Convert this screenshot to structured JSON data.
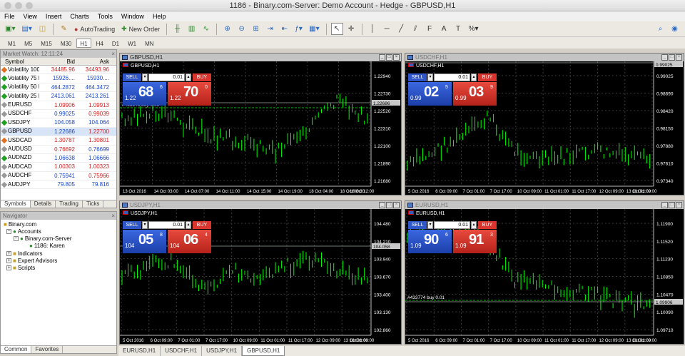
{
  "window": {
    "title": "1186 - Binary.com-Server: Demo Account - Hedge - GBPUSD,H1"
  },
  "menu": [
    "File",
    "View",
    "Insert",
    "Charts",
    "Tools",
    "Window",
    "Help"
  ],
  "toolbar": {
    "autotrading": "AutoTrading",
    "new_order": "New Order"
  },
  "timeframes": [
    "M1",
    "M5",
    "M15",
    "M30",
    "H1",
    "H4",
    "D1",
    "W1",
    "MN"
  ],
  "market_watch": {
    "title": "Market Watch: 12:11:24",
    "headers": {
      "symbol": "Symbol",
      "bid": "Bid",
      "ask": "Ask"
    },
    "rows": [
      {
        "symbol": "Volatility 100 In...",
        "bid": "34485.96",
        "ask": "34493.96",
        "bidc": "#d02020",
        "askc": "#d02020",
        "icon": "#e07020"
      },
      {
        "symbol": "Volatility 75 Index",
        "bid": "15926....",
        "ask": "15930....",
        "bidc": "#1a47c8",
        "askc": "#1a47c8",
        "icon": "#20a020"
      },
      {
        "symbol": "Volatility 50 Index",
        "bid": "464.2872",
        "ask": "464.3472",
        "bidc": "#1a47c8",
        "askc": "#1a47c8",
        "icon": "#20a020"
      },
      {
        "symbol": "Volatility 25 Index",
        "bid": "2413.061",
        "ask": "2413.261",
        "bidc": "#1a47c8",
        "askc": "#1a47c8",
        "icon": "#20a020"
      },
      {
        "symbol": "EURUSD",
        "bid": "1.09906",
        "ask": "1.09913",
        "bidc": "#d02020",
        "askc": "#d02020",
        "icon": "#999999"
      },
      {
        "symbol": "USDCHF",
        "bid": "0.99025",
        "ask": "0.99039",
        "bidc": "#1a47c8",
        "askc": "#d02020",
        "icon": "#999999"
      },
      {
        "symbol": "USDJPY",
        "bid": "104.058",
        "ask": "104.064",
        "bidc": "#1a47c8",
        "askc": "#1a47c8",
        "icon": "#20a020"
      },
      {
        "symbol": "GBPUSD",
        "bid": "1.22686",
        "ask": "1.22700",
        "bidc": "#1a47c8",
        "askc": "#d02020",
        "icon": "#999999",
        "selected": true
      },
      {
        "symbol": "USDCAD",
        "bid": "1.30787",
        "ask": "1.30801",
        "bidc": "#d02020",
        "askc": "#d02020",
        "icon": "#e07020"
      },
      {
        "symbol": "AUDUSD",
        "bid": "0.76692",
        "ask": "0.76699",
        "bidc": "#d02020",
        "askc": "#1a47c8",
        "icon": "#999999"
      },
      {
        "symbol": "AUDNZD",
        "bid": "1.06638",
        "ask": "1.06666",
        "bidc": "#1a47c8",
        "askc": "#1a47c8",
        "icon": "#20a020"
      },
      {
        "symbol": "AUDCAD",
        "bid": "1.00303",
        "ask": "1.00323",
        "bidc": "#d02020",
        "askc": "#d02020",
        "icon": "#999999"
      },
      {
        "symbol": "AUDCHF",
        "bid": "0.75941",
        "ask": "0.75966",
        "bidc": "#1a47c8",
        "askc": "#d02020",
        "icon": "#999999"
      },
      {
        "symbol": "AUDJPY",
        "bid": "79.805",
        "ask": "79.816",
        "bidc": "#1a47c8",
        "askc": "#1a47c8",
        "icon": "#999999"
      }
    ],
    "tabs": [
      "Symbols",
      "Details",
      "Trading",
      "Ticks"
    ]
  },
  "navigator": {
    "title": "Navigator",
    "root": "Binary.com",
    "accounts": "Accounts",
    "server": "Binary.com-Server",
    "account": "1186: Karen",
    "indicators": "Indicators",
    "experts": "Expert Advisors",
    "scripts": "Scripts",
    "tabs": [
      "Common",
      "Favorites"
    ]
  },
  "trade_panel": {
    "sell": "SELL",
    "buy": "BUY",
    "volume": "0.01"
  },
  "charts": [
    {
      "id": "gbpusd",
      "title": "GBPUSD,H1",
      "label": "GBPUSD,H1",
      "active": true,
      "sell": {
        "small": "1.22",
        "big": "68",
        "pip": "6"
      },
      "buy": {
        "small": "1.22",
        "big": "70",
        "pip": "0"
      },
      "yticks": [
        "1.22940",
        "1.22730",
        "1.22520",
        "1.22310",
        "1.22100",
        "1.21890",
        "1.21680"
      ],
      "xticks": [
        "13 Oct 2016",
        "14 Oct 03:00",
        "14 Oct 07:00",
        "14 Oct 11:00",
        "14 Oct 15:00",
        "14 Oct 19:00",
        "18 Oct 04:00",
        "18 Oct 08:00",
        "18 Oct 12:00"
      ],
      "price_tag": "1.22686",
      "order": "#433348 buy 0.01",
      "seed": 3,
      "trend": [
        0.55,
        0.62,
        0.48,
        0.35,
        0.3,
        0.2,
        0.45,
        0.7,
        0.55
      ]
    },
    {
      "id": "usdchf",
      "title": "USDCHF,H1",
      "label": "USDCHF,H1",
      "active": false,
      "sell": {
        "small": "0.99",
        "big": "02",
        "pip": "5"
      },
      "buy": {
        "small": "0.99",
        "big": "03",
        "pip": "9"
      },
      "yticks": [
        "0.99025",
        "0.98690",
        "0.98420",
        "0.98150",
        "0.97880",
        "0.97610",
        "0.97340"
      ],
      "xticks": [
        "5 Oct 2016",
        "6 Oct 09:00",
        "7 Oct 01:00",
        "7 Oct 17:00",
        "10 Oct 09:00",
        "11 Oct 01:00",
        "11 Oct 17:00",
        "12 Oct 09:00",
        "13 Oct 01:00",
        "18 Oct 09:00"
      ],
      "price_tag": "0.99025",
      "order": "",
      "seed": 7,
      "trend": [
        0.05,
        0.2,
        0.35,
        0.55,
        0.2,
        0.1,
        0.15,
        0.2,
        0.15,
        0.1
      ]
    },
    {
      "id": "usdjpy",
      "title": "USDJPY,H1",
      "label": "USDJPY,H1",
      "active": false,
      "sell": {
        "small": "104",
        "big": "05",
        "pip": "8"
      },
      "buy": {
        "small": "104",
        "big": "06",
        "pip": "4"
      },
      "yticks": [
        "104.480",
        "104.210",
        "103.940",
        "103.670",
        "103.400",
        "103.130",
        "102.860"
      ],
      "xticks": [
        "5 Oct 2016",
        "6 Oct 09:00",
        "7 Oct 01:00",
        "7 Oct 17:00",
        "10 Oct 09:00",
        "11 Oct 01:00",
        "11 Oct 17:00",
        "12 Oct 09:00",
        "13 Oct 01:00",
        "18 Oct 09:00"
      ],
      "price_tag": "104.058",
      "order": "",
      "seed": 11,
      "trend": [
        0.45,
        0.55,
        0.6,
        0.3,
        0.5,
        0.45,
        0.55,
        0.6,
        0.5,
        0.4
      ]
    },
    {
      "id": "eurusd",
      "title": "EURUSD,H1",
      "label": "EURUSD,H1",
      "active": false,
      "sell": {
        "small": "1.09",
        "big": "90",
        "pip": "6"
      },
      "buy": {
        "small": "1.09",
        "big": "91",
        "pip": "3"
      },
      "yticks": [
        "1.11900",
        "1.11520",
        "1.11230",
        "1.10850",
        "1.10470",
        "1.10090",
        "1.09710"
      ],
      "xticks": [
        "5 Oct 2016",
        "6 Oct 09:00",
        "7 Oct 01:00",
        "7 Oct 17:00",
        "10 Oct 09:00",
        "11 Oct 01:00",
        "11 Oct 17:00",
        "12 Oct 09:00",
        "13 Oct 01:00",
        "18 Oct 09:00"
      ],
      "price_tag": "1.09906",
      "order": "#433774 buy 0.01",
      "seed": 19,
      "trend": [
        0.9,
        0.85,
        0.95,
        0.8,
        0.4,
        0.35,
        0.3,
        0.25,
        0.18,
        0.12
      ]
    }
  ],
  "bottom_tabs": [
    "EURUSD,H1",
    "USDCHF,H1",
    "USDJPY,H1",
    "GBPUSD,H1"
  ]
}
